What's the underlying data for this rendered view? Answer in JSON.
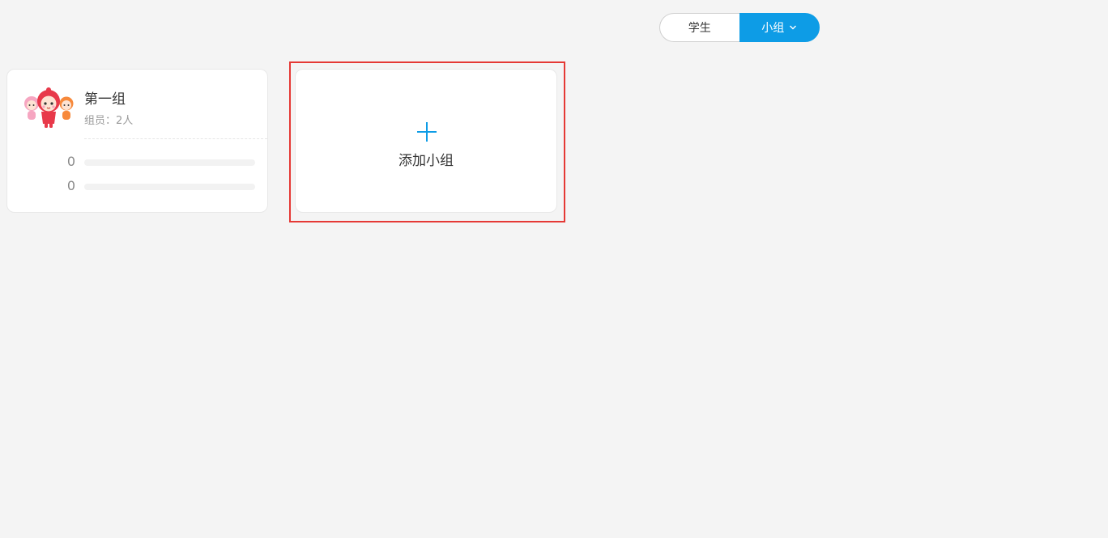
{
  "toggle": {
    "student_label": "学生",
    "group_label": "小组",
    "active": "group",
    "accent_color": "#0d9ce6"
  },
  "groups": [
    {
      "name": "第一组",
      "members_text": "组员：2人",
      "avatar_icon": "cartoon-kids-avatar",
      "stats": [
        {
          "value": "0",
          "progress": 0
        },
        {
          "value": "0",
          "progress": 0
        }
      ]
    }
  ],
  "add_group": {
    "label": "添加小组",
    "icon": "plus-icon",
    "highlight_color": "#e53935"
  }
}
